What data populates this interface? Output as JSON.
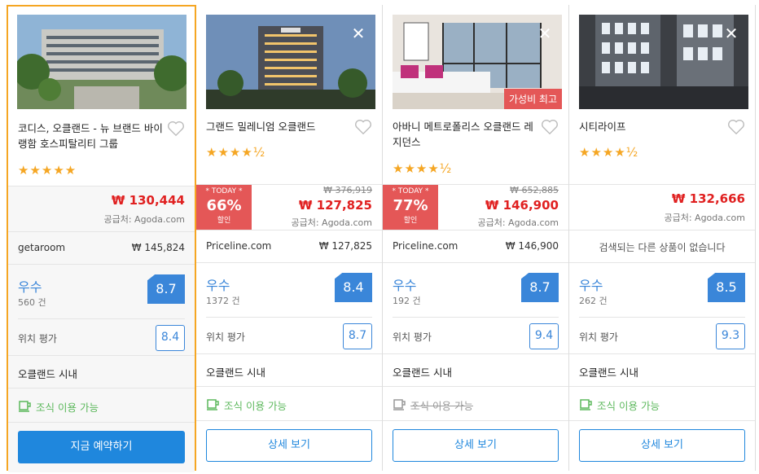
{
  "hotels": [
    {
      "name": "코디스, 오클랜드 - 뉴 브랜드 바이 랭함 호스피탈리티 그룹",
      "stars": "★★★★★",
      "price": "₩ 130,444",
      "supplier": "공급처: Agoda.com",
      "alt_name": "getaroom",
      "alt_price": "₩ 145,824",
      "rating_label": "우수",
      "review_count": "560 건",
      "score": "8.7",
      "location_label": "위치 평가",
      "location_score": "8.4",
      "area": "오클랜드 시내",
      "breakfast": "조식 이용 가능",
      "button": "지금 예약하기"
    },
    {
      "name": "그랜드 밀레니엄 오클랜드",
      "stars": "★★★★½",
      "today_label": "* TODAY *",
      "discount": "66%",
      "discount_sub": "할인",
      "old_price": "₩ 376,919",
      "price": "₩ 127,825",
      "supplier": "공급처: Agoda.com",
      "alt_name": "Priceline.com",
      "alt_price": "₩ 127,825",
      "rating_label": "우수",
      "review_count": "1372 건",
      "score": "8.4",
      "location_label": "위치 평가",
      "location_score": "8.7",
      "area": "오클랜드 시내",
      "breakfast": "조식 이용 가능",
      "button": "상세 보기",
      "close": "✕"
    },
    {
      "name": "아바니 메트로폴리스 오클랜드 레지던스",
      "stars": "★★★★½",
      "badge": "가성비 최고",
      "today_label": "* TODAY *",
      "discount": "77%",
      "discount_sub": "할인",
      "old_price": "₩ 652,885",
      "price": "₩ 146,900",
      "supplier": "공급처: Agoda.com",
      "alt_name": "Priceline.com",
      "alt_price": "₩ 146,900",
      "rating_label": "우수",
      "review_count": "192 건",
      "score": "8.7",
      "location_label": "위치 평가",
      "location_score": "9.4",
      "area": "오클랜드 시내",
      "breakfast": "조식 이용 가능",
      "button": "상세 보기",
      "close": "✕"
    },
    {
      "name": "시티라이프",
      "stars": "★★★★½",
      "price": "₩ 132,666",
      "supplier": "공급처: Agoda.com",
      "alt_none": "검색되는 다른 상품이 없습니다",
      "rating_label": "우수",
      "review_count": "262 건",
      "score": "8.5",
      "location_label": "위치 평가",
      "location_score": "9.3",
      "area": "오클랜드 시내",
      "breakfast": "조식 이용 가능",
      "button": "상세 보기",
      "close": "✕"
    }
  ],
  "colors": {
    "accent": "#1f87dd",
    "price": "#e02020",
    "deal": "#e45757",
    "star": "#f5a623",
    "rating": "#3a86d9",
    "breakfast": "#5cb85c",
    "highlight_border": "#f5a623"
  }
}
